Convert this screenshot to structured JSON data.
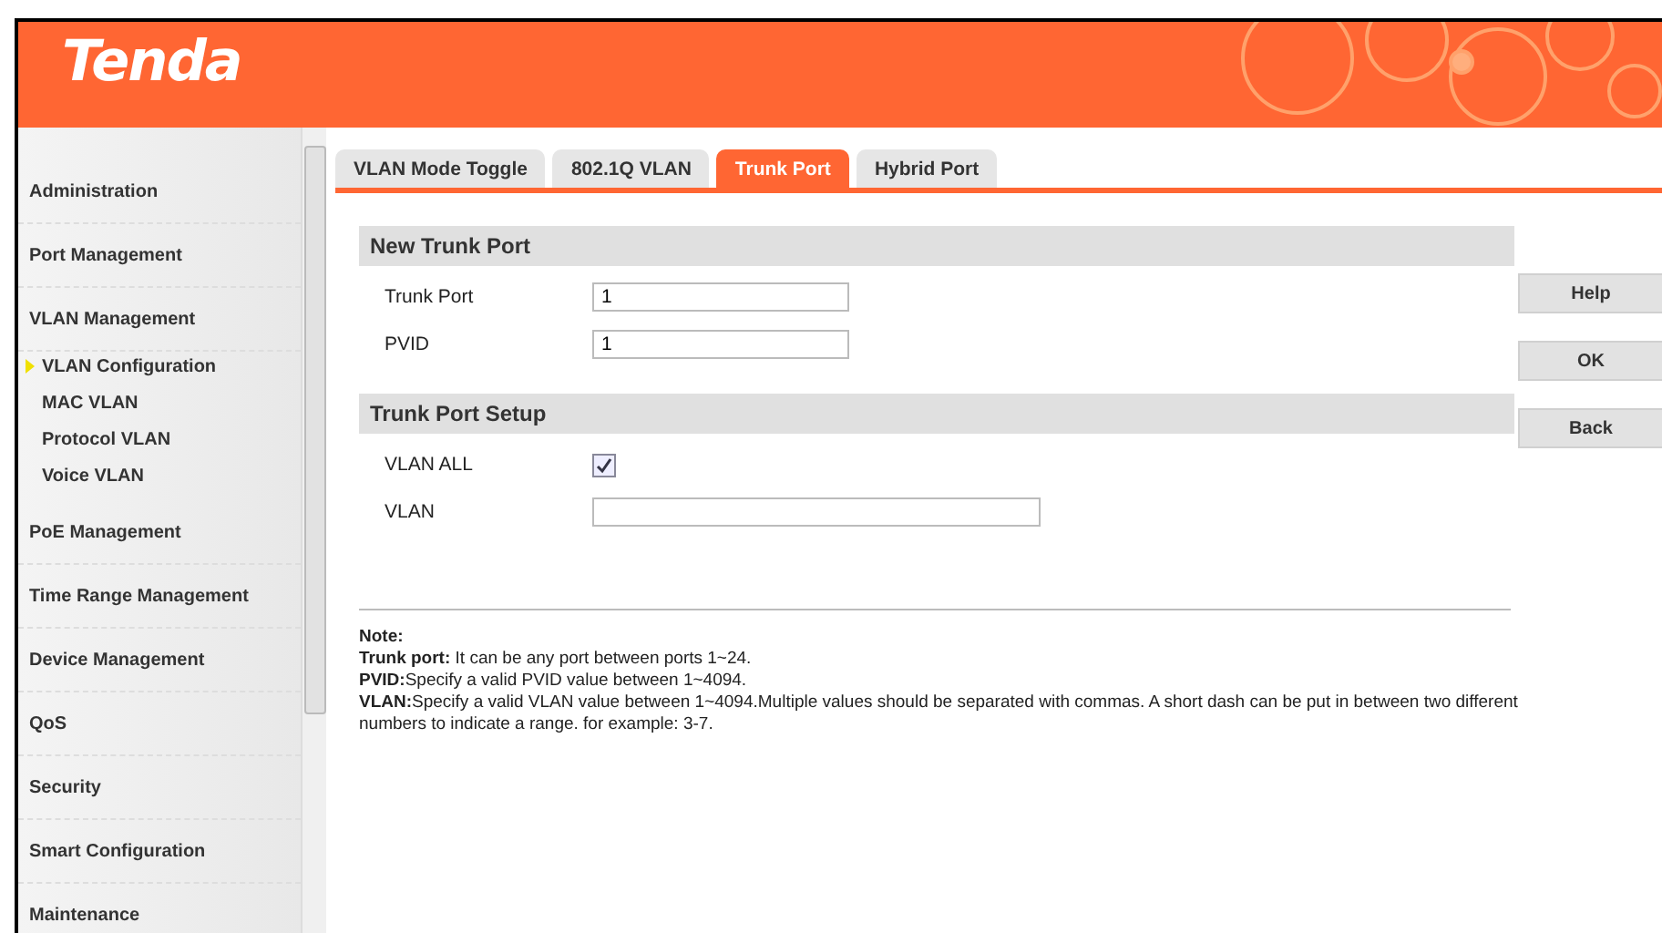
{
  "header": {
    "logo": "Tenda"
  },
  "sidebar": {
    "items": [
      {
        "label": "Administration",
        "selected": false
      },
      {
        "label": "Port Management",
        "selected": false
      },
      {
        "label": "VLAN Management",
        "selected": false,
        "children": [
          {
            "label": "VLAN Configuration",
            "selected": true
          },
          {
            "label": "MAC VLAN",
            "selected": false
          },
          {
            "label": "Protocol VLAN",
            "selected": false
          },
          {
            "label": "Voice VLAN",
            "selected": false
          }
        ]
      },
      {
        "label": "PoE Management",
        "selected": false
      },
      {
        "label": "Time Range Management",
        "selected": false
      },
      {
        "label": "Device Management",
        "selected": false
      },
      {
        "label": "QoS",
        "selected": false
      },
      {
        "label": "Security",
        "selected": false
      },
      {
        "label": "Smart Configuration",
        "selected": false
      },
      {
        "label": "Maintenance",
        "selected": false
      }
    ]
  },
  "tabs": [
    {
      "label": "VLAN Mode Toggle",
      "selected": false
    },
    {
      "label": "802.1Q VLAN",
      "selected": false
    },
    {
      "label": "Trunk Port",
      "selected": true
    },
    {
      "label": "Hybrid Port",
      "selected": false
    }
  ],
  "sections": [
    {
      "title": "New Trunk Port",
      "rows": [
        {
          "kind": "text",
          "label": "Trunk Port",
          "value": "1"
        },
        {
          "kind": "text",
          "label": "PVID",
          "value": "1"
        }
      ]
    },
    {
      "title": "Trunk Port Setup",
      "rows": [
        {
          "kind": "checkbox",
          "label": "VLAN ALL",
          "checked": true
        },
        {
          "kind": "wide",
          "label": "VLAN",
          "value": ""
        }
      ]
    }
  ],
  "buttons": [
    "Help",
    "OK",
    "Back"
  ],
  "note": {
    "title": "Note:",
    "lines": [
      "**Trunk port:** It can be any port between ports 1~24.",
      "**PVID:**Specify a valid PVID value between 1~4094.",
      "**VLAN:**Specify a valid VLAN value  between 1~4094.Multiple values should be separated with commas. A short dash can be put in between two different numbers to indicate a range. for example: 3-7."
    ]
  }
}
